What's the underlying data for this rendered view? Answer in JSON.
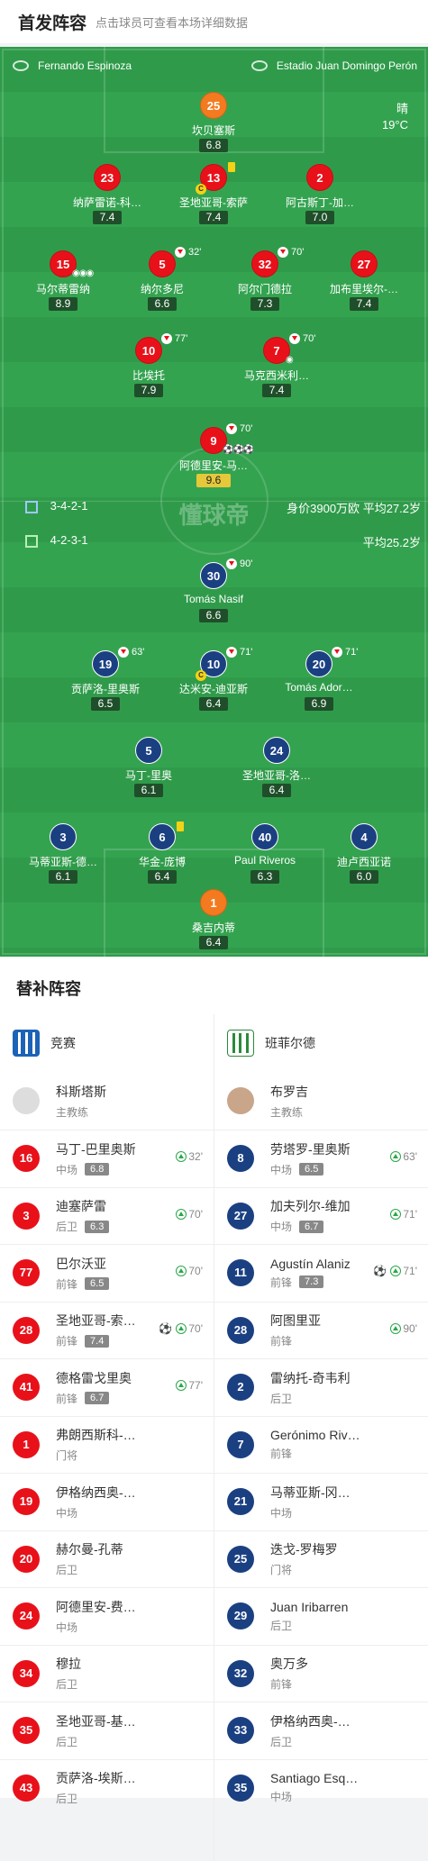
{
  "header": {
    "title": "首发阵容",
    "subtitle": "点击球员可查看本场详细数据"
  },
  "match": {
    "referee": "Fernando Espinoza",
    "venue": "Estadio Juan Domingo Perón",
    "weather": "晴",
    "temperature": "19°C"
  },
  "home_info": {
    "formation": "3-4-2-1",
    "value": "身价3900万欧",
    "avg_age": "平均27.2岁"
  },
  "away_info": {
    "formation": "4-2-3-1",
    "avg_age": "平均25.2岁"
  },
  "watermark": "懂球帝",
  "home_starters": [
    {
      "num": "25",
      "name": "坎贝塞斯",
      "rating": "6.8"
    },
    {
      "num": "23",
      "name": "纳萨雷诺-科…",
      "rating": "7.4"
    },
    {
      "num": "13",
      "name": "圣地亚哥-索萨",
      "rating": "7.4"
    },
    {
      "num": "2",
      "name": "阿古斯丁-加…",
      "rating": "7.0"
    },
    {
      "num": "15",
      "name": "马尔蒂雷纳",
      "rating": "8.9"
    },
    {
      "num": "5",
      "name": "纳尔多尼",
      "rating": "6.6",
      "sub": "32'"
    },
    {
      "num": "32",
      "name": "阿尔门德拉",
      "rating": "7.3",
      "sub": "70'"
    },
    {
      "num": "27",
      "name": "加布里埃尔-…",
      "rating": "7.4"
    },
    {
      "num": "10",
      "name": "比埃托",
      "rating": "7.9",
      "sub": "77'"
    },
    {
      "num": "7",
      "name": "马克西米利…",
      "rating": "7.4",
      "sub": "70'"
    },
    {
      "num": "9",
      "name": "阿德里安-马…",
      "rating": "9.6",
      "sub": "70'"
    }
  ],
  "away_starters": [
    {
      "num": "30",
      "name": "Tomás Nasif",
      "rating": "6.6",
      "sub": "90'"
    },
    {
      "num": "19",
      "name": "贡萨洛-里奥斯",
      "rating": "6.5",
      "sub": "63'"
    },
    {
      "num": "10",
      "name": "达米安-迪亚斯",
      "rating": "6.4",
      "sub": "71'"
    },
    {
      "num": "20",
      "name": "Tomás Ador…",
      "rating": "6.9",
      "sub": "71'"
    },
    {
      "num": "5",
      "name": "马丁-里奥",
      "rating": "6.1"
    },
    {
      "num": "24",
      "name": "圣地亚哥-洛…",
      "rating": "6.4"
    },
    {
      "num": "3",
      "name": "马蒂亚斯-德…",
      "rating": "6.1"
    },
    {
      "num": "6",
      "name": "华金-庞博",
      "rating": "6.4"
    },
    {
      "num": "40",
      "name": "Paul Riveros",
      "rating": "6.3"
    },
    {
      "num": "4",
      "name": "迪卢西亚诺",
      "rating": "6.0"
    },
    {
      "num": "1",
      "name": "桑吉内蒂",
      "rating": "6.4"
    }
  ],
  "subs": {
    "title": "替补阵容",
    "home": {
      "team": "竞赛",
      "coach": {
        "name": "科斯塔斯",
        "role": "主教练"
      },
      "players": [
        {
          "num": "16",
          "name": "马丁-巴里奥斯",
          "pos": "中场",
          "rating": "6.8",
          "time": "32'"
        },
        {
          "num": "3",
          "name": "迪塞萨雷",
          "pos": "后卫",
          "rating": "6.3",
          "time": "70'"
        },
        {
          "num": "77",
          "name": "巴尔沃亚",
          "pos": "前锋",
          "rating": "6.5",
          "time": "70'"
        },
        {
          "num": "28",
          "name": "圣地亚哥-索…",
          "pos": "前锋",
          "rating": "7.4",
          "time": "70'",
          "goal": "⚽"
        },
        {
          "num": "41",
          "name": "德格雷戈里奥",
          "pos": "前锋",
          "rating": "6.7",
          "time": "77'"
        },
        {
          "num": "1",
          "name": "弗朗西斯科-…",
          "pos": "门将"
        },
        {
          "num": "19",
          "name": "伊格纳西奥-…",
          "pos": "中场"
        },
        {
          "num": "20",
          "name": "赫尔曼-孔蒂",
          "pos": "后卫"
        },
        {
          "num": "24",
          "name": "阿德里安-费…",
          "pos": "中场"
        },
        {
          "num": "34",
          "name": "穆拉",
          "pos": "后卫"
        },
        {
          "num": "35",
          "name": "圣地亚哥-基…",
          "pos": "后卫"
        },
        {
          "num": "43",
          "name": "贡萨洛-埃斯…",
          "pos": "后卫"
        }
      ]
    },
    "away": {
      "team": "班菲尔德",
      "coach": {
        "name": "布罗吉",
        "role": "主教练"
      },
      "players": [
        {
          "num": "8",
          "name": "劳塔罗-里奥斯",
          "pos": "中场",
          "rating": "6.5",
          "time": "63'"
        },
        {
          "num": "27",
          "name": "加夫列尔-维加",
          "pos": "中场",
          "rating": "6.7",
          "time": "71'"
        },
        {
          "num": "11",
          "name": "Agustín Alaniz",
          "pos": "前锋",
          "rating": "7.3",
          "time": "71'",
          "goal": "⚽"
        },
        {
          "num": "28",
          "name": "阿图里亚",
          "pos": "前锋",
          "time": "90'"
        },
        {
          "num": "2",
          "name": "雷纳托-奇韦利",
          "pos": "后卫"
        },
        {
          "num": "7",
          "name": "Gerónimo Riv…",
          "pos": "前锋"
        },
        {
          "num": "21",
          "name": "马蒂亚斯-冈…",
          "pos": "中场"
        },
        {
          "num": "25",
          "name": "迭戈-罗梅罗",
          "pos": "门将"
        },
        {
          "num": "29",
          "name": "Juan Iribarren",
          "pos": "后卫"
        },
        {
          "num": "32",
          "name": "奥万多",
          "pos": "前锋"
        },
        {
          "num": "33",
          "name": "伊格纳西奥-…",
          "pos": "后卫"
        },
        {
          "num": "35",
          "name": "Santiago Esq…",
          "pos": "中场"
        }
      ]
    }
  }
}
